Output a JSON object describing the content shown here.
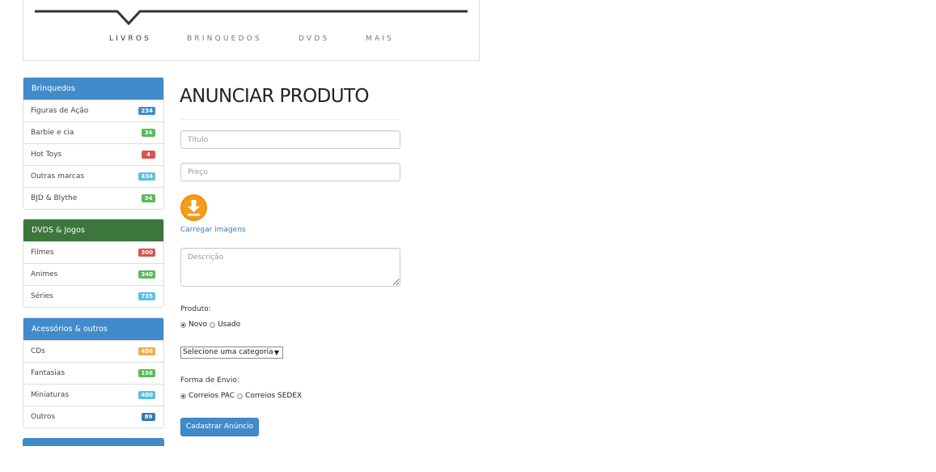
{
  "nav": {
    "items": [
      "LIVROS",
      "BRINQUEDOS",
      "DVDS",
      "MAIS"
    ],
    "active": "LIVROS"
  },
  "sidebar": {
    "panels": [
      {
        "title": "Brinquedos",
        "heading_color": "#428bca",
        "items": [
          {
            "label": "Figuras de Ação",
            "count": "234",
            "badge_color": "#428bca"
          },
          {
            "label": "Barbie e cia",
            "count": "34",
            "badge_color": "#5cb85c"
          },
          {
            "label": "Hot Toys",
            "count": "4",
            "badge_color": "#d9534f"
          },
          {
            "label": "Outras marcas",
            "count": "434",
            "badge_color": "#5bc0de"
          },
          {
            "label": "BJD & Blythe",
            "count": "34",
            "badge_color": "#5cb85c"
          }
        ]
      },
      {
        "title": "DVDS & Jogos",
        "heading_color": "#3c763d",
        "items": [
          {
            "label": "Filmes",
            "count": "300",
            "badge_color": "#d9534f"
          },
          {
            "label": "Animes",
            "count": "340",
            "badge_color": "#5cb85c"
          },
          {
            "label": "Séries",
            "count": "735",
            "badge_color": "#5bc0de"
          }
        ]
      },
      {
        "title": "Acessórios & outros",
        "heading_color": "#428bca",
        "items": [
          {
            "label": "CDs",
            "count": "456",
            "badge_color": "#f0ad4e"
          },
          {
            "label": "Fantasias",
            "count": "156",
            "badge_color": "#5cb85c"
          },
          {
            "label": "Miniaturas",
            "count": "400",
            "badge_color": "#5bc0de"
          },
          {
            "label": "Outros",
            "count": "89",
            "badge_color": "#337ab7"
          }
        ]
      }
    ]
  },
  "form": {
    "title": "ANUNCIAR PRODUTO",
    "titulo_placeholder": "Título",
    "preco_placeholder": "Preço",
    "upload_icon": "download-icon",
    "upload_link": "Carregar imagens",
    "descricao_placeholder": "Descrição",
    "produto_label": "Produto:",
    "produto_options": [
      "Novo",
      "Usado"
    ],
    "produto_selected": "Novo",
    "categoria_selected": "Selecione uma categoria",
    "envio_label": "Forma de Envio:",
    "envio_options": [
      "Correios PAC",
      "Correios SEDEX"
    ],
    "envio_selected": "Correios PAC",
    "submit_label": "Cadastrar Anúncio"
  },
  "colors": {
    "primary": "#428bca",
    "success_dark": "#3c763d",
    "upload_orange": "#f0910e",
    "link": "#3a7cb8"
  }
}
